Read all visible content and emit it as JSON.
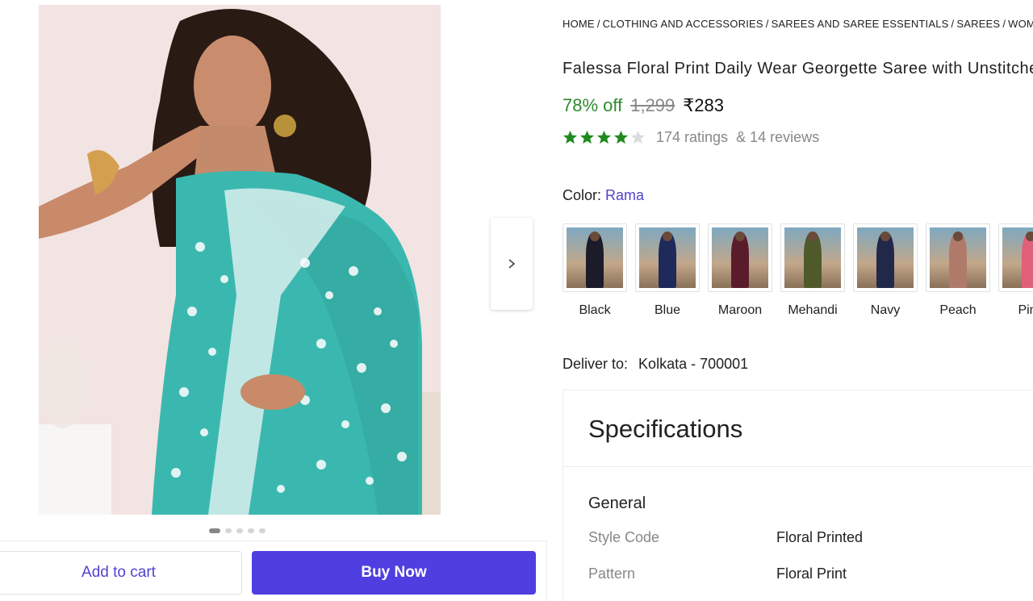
{
  "breadcrumb": [
    "HOME",
    "CLOTHING AND ACCESSORIES",
    "SAREES AND SAREE ESSENTIALS",
    "SAREES",
    "WOMEN"
  ],
  "product": {
    "title": "Falessa Floral Print Daily Wear Georgette Saree with Unstitched",
    "discount": "78% off",
    "mrp": "1,299",
    "price": "₹283",
    "rating_stars": 4,
    "ratings": "174 ratings",
    "reviews": "& 14 reviews"
  },
  "color": {
    "label": "Color:",
    "selected": "Rama",
    "options": [
      {
        "name": "Black",
        "color": "#1b1b2a"
      },
      {
        "name": "Blue",
        "color": "#1d2a5a"
      },
      {
        "name": "Maroon",
        "color": "#5a1c2a"
      },
      {
        "name": "Mehandi",
        "color": "#4e5a2a"
      },
      {
        "name": "Navy",
        "color": "#22284a"
      },
      {
        "name": "Peach",
        "color": "#b07a6a"
      },
      {
        "name": "Pink",
        "color": "#e0607a"
      }
    ]
  },
  "delivery": {
    "label": "Deliver to:",
    "location": "Kolkata - 700001"
  },
  "specifications": {
    "title": "Specifications",
    "section": "General",
    "rows": [
      {
        "key": "Style Code",
        "value": "Floral Printed"
      },
      {
        "key": "Pattern",
        "value": "Floral Print"
      }
    ]
  },
  "gallery": {
    "image_count": 5,
    "active_index": 0
  },
  "actions": {
    "add_to_cart": "Add to cart",
    "buy_now": "Buy Now"
  },
  "colors": {
    "accent": "#4f3fe0",
    "discount_green": "#2e8b2e",
    "star_green": "#1e8a1e",
    "saree_teal": "#3ab8b0"
  }
}
